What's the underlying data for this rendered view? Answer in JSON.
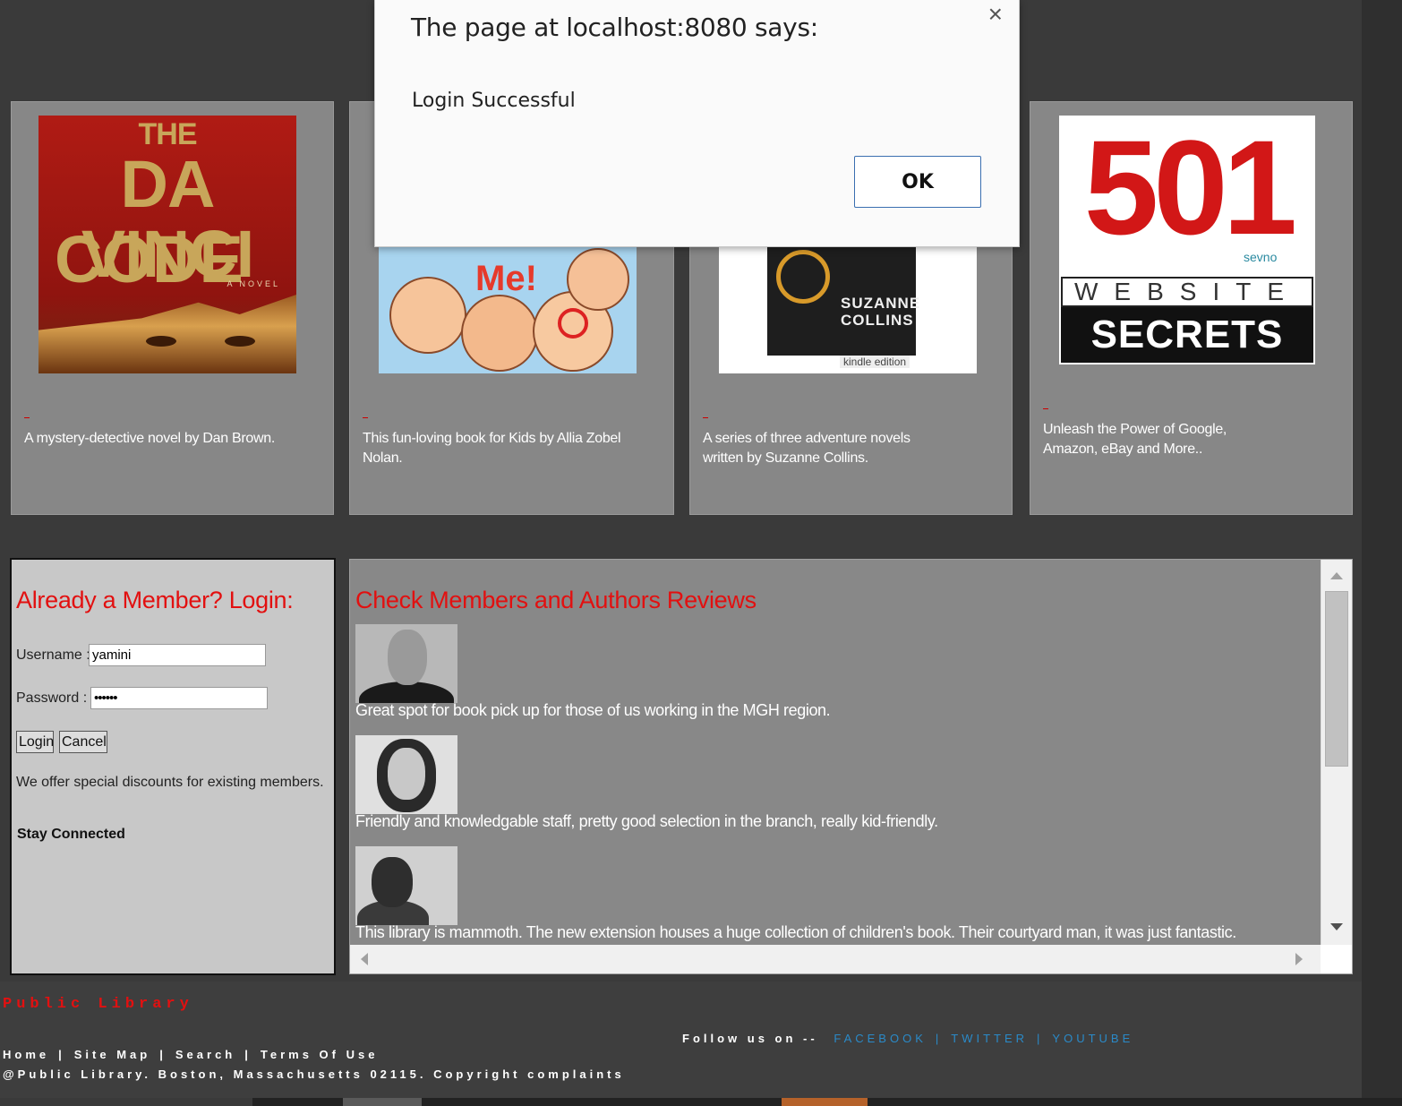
{
  "dialog": {
    "title": "The page at localhost:8080 says:",
    "message": "Login Successful",
    "ok_label": "OK",
    "close_glyph": "×"
  },
  "books": [
    {
      "cover_lines": [
        "THE",
        "DA VINCI",
        "CODE"
      ],
      "cover_subtitle": "A NOVEL",
      "description": "A mystery-detective novel by Dan Brown."
    },
    {
      "cover_title": "Me!",
      "description": "This fun-loving book for Kids by Allia Zobel Nolan."
    },
    {
      "cover_author": "SUZANNE COLLINS",
      "cover_badge": "kindle edition",
      "description": "A series of three adventure novels written by Suzanne Collins."
    },
    {
      "cover_number": "501",
      "cover_word": "WEBSITE",
      "cover_secrets": "SECRETS",
      "cover_brand": "sevno",
      "description": "Unleash the Power of Google, Amazon, eBay and More.."
    }
  ],
  "login": {
    "heading": "Already a Member? Login:",
    "username_label": "Username :",
    "username_value": "yamini",
    "password_label": "Password :",
    "password_value": "••••••",
    "login_button": "Login",
    "cancel_button": "Cancel",
    "offer_text": "We offer special discounts for existing members.",
    "stay_connected": "Stay Connected"
  },
  "reviews": {
    "heading": "Check Members and Authors Reviews",
    "items": [
      {
        "text": "Great spot for book pick up for those of us working in the MGH region."
      },
      {
        "text": "Friendly and knowledgable staff, pretty good selection in the branch, really kid-friendly."
      },
      {
        "text": "This library is mammoth. The new extension houses a huge collection of children's book. Their courtyard man, it was just fantastic."
      }
    ]
  },
  "footer": {
    "brand": "Public Library",
    "follow_label": "Follow us on --",
    "social": [
      "FACEBOOK",
      "TWITTER",
      "YOUTUBE"
    ],
    "social_separator": "|",
    "links": [
      "Home",
      "Site Map",
      "Search",
      "Terms Of Use"
    ],
    "link_separator": "|",
    "copyright": "@Public Library. Boston, Massachusetts 02115. Copyright complaints"
  },
  "colors": {
    "accent_red": "#e21010",
    "social_blue": "#2a8ac8",
    "card_gray": "#878787",
    "page_bg": "#3a3a3a"
  }
}
